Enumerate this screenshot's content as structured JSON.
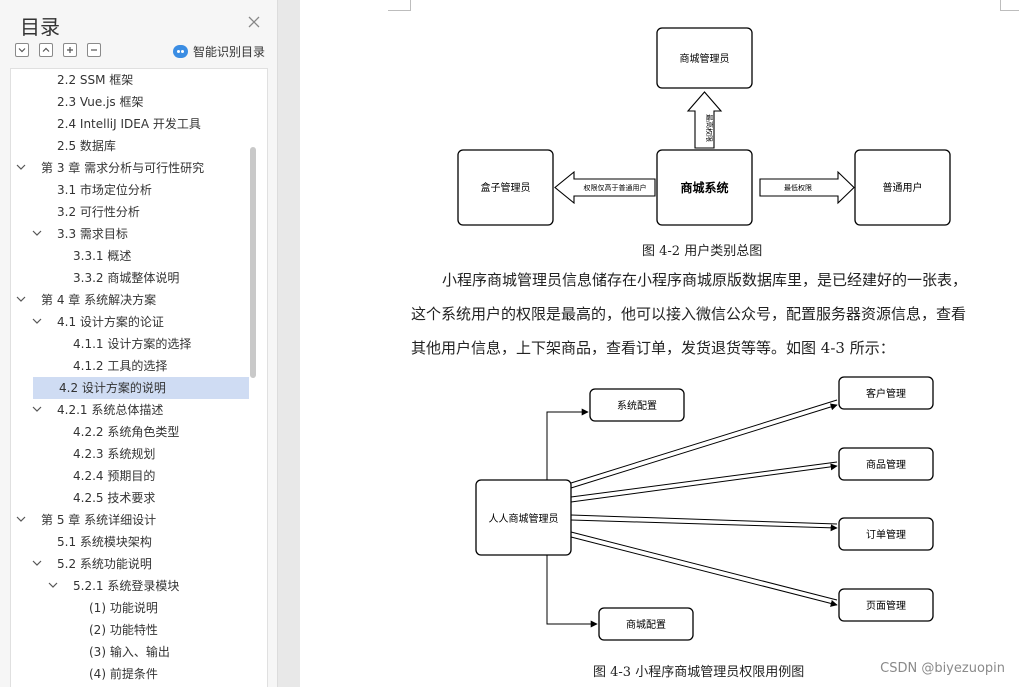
{
  "toc": {
    "title": "目录",
    "ai_label": "智能识别目录",
    "items": [
      {
        "text": "2.2 SSM 框架",
        "indent": 1,
        "caret": "none"
      },
      {
        "text": "2.3 Vue.js 框架",
        "indent": 1,
        "caret": "none"
      },
      {
        "text": "2.4 IntelliJ IDEA 开发工具",
        "indent": 1,
        "caret": "none"
      },
      {
        "text": "2.5  数据库",
        "indent": 1,
        "caret": "none"
      },
      {
        "text": "第 3 章  需求分析与可行性研究",
        "indent": 0,
        "caret": "down"
      },
      {
        "text": "3.1  市场定位分析",
        "indent": 1,
        "caret": "none"
      },
      {
        "text": "3.2  可行性分析",
        "indent": 1,
        "caret": "none"
      },
      {
        "text": "3.3  需求目标",
        "indent": 1,
        "caret": "down"
      },
      {
        "text": "3.3.1  概述",
        "indent": 2,
        "caret": "none"
      },
      {
        "text": "3.3.2  商城整体说明",
        "indent": 2,
        "caret": "none"
      },
      {
        "text": "第 4 章  系统解决方案",
        "indent": 0,
        "caret": "down"
      },
      {
        "text": "4.1  设计方案的论证",
        "indent": 1,
        "caret": "down"
      },
      {
        "text": "4.1.1  设计方案的选择",
        "indent": 2,
        "caret": "none"
      },
      {
        "text": "4.1.2  工具的选择",
        "indent": 2,
        "caret": "none"
      },
      {
        "text": "4.2  设计方案的说明",
        "indent": 1,
        "caret": "none",
        "selected": true
      },
      {
        "text": "4.2.1  系统总体描述",
        "indent": 1,
        "caret": "down"
      },
      {
        "text": "4.2.2  系统角色类型",
        "indent": 2,
        "caret": "none"
      },
      {
        "text": "4.2.3  系统规划",
        "indent": 2,
        "caret": "none"
      },
      {
        "text": "4.2.4  预期目的",
        "indent": 2,
        "caret": "none"
      },
      {
        "text": "4.2.5  技术要求",
        "indent": 2,
        "caret": "none"
      },
      {
        "text": "第 5 章  系统详细设计",
        "indent": 0,
        "caret": "down"
      },
      {
        "text": "5.1  系统模块架构",
        "indent": 1,
        "caret": "none"
      },
      {
        "text": "5.2  系统功能说明",
        "indent": 1,
        "caret": "down"
      },
      {
        "text": "5.2.1  系统登录模块",
        "indent": 2,
        "caret": "down"
      },
      {
        "text": "(1)  功能说明",
        "indent": 3,
        "caret": "none"
      },
      {
        "text": "(2)  功能特性",
        "indent": 3,
        "caret": "none"
      },
      {
        "text": "(3)  输入、输出",
        "indent": 3,
        "caret": "none"
      },
      {
        "text": "(4)  前提条件",
        "indent": 3,
        "caret": "none"
      }
    ]
  },
  "diagram1": {
    "top": "商城管理员",
    "center": "商城系统",
    "left": "盒子管理员",
    "right": "普通用户",
    "arrow_up": "最高权限",
    "arrow_left": "权限仅高于普通用户",
    "arrow_right": "最低权限"
  },
  "caption1": "图 4-2  用户类别总图",
  "paragraph": [
    "小程序商城管理员信息储存在小程序商城原版数据库里，是已经建好的一张表，",
    "这个系统用户的权限是最高的，他可以接入微信公众号，配置服务器资源信息，查看",
    "其他用户信息，上下架商品，查看订单，发货退货等等。如图 4-3 所示："
  ],
  "diagram2": {
    "actor": "人人商城管理员",
    "sys_config": "系统配置",
    "mall_config": "商城配置",
    "customers": "客户管理",
    "products": "商品管理",
    "orders": "订单管理",
    "pages": "页面管理"
  },
  "caption2": "图 4-3  小程序商城管理员权限用例图",
  "watermark": "CSDN @biyezuopin",
  "colors": {
    "selected_bg": "#cfdcf3",
    "ai_icon": "#3b8de3"
  }
}
